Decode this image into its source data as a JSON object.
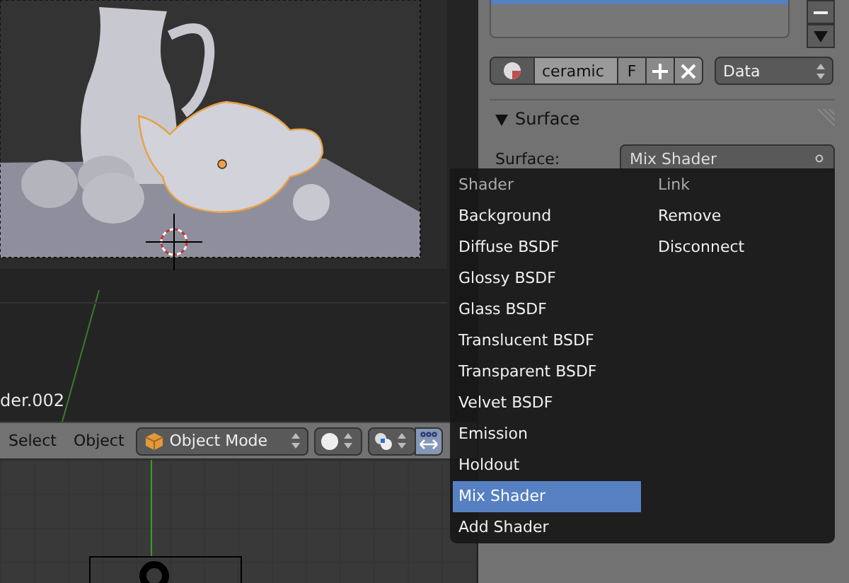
{
  "viewport": {
    "object_name": "der.002"
  },
  "header": {
    "menus": [
      "Select",
      "Object"
    ],
    "mode": "Object Mode"
  },
  "properties": {
    "material": {
      "name": "ceramic",
      "fake_user": "F",
      "link": "Data"
    },
    "surface_panel": {
      "title": "Surface",
      "expanded": true,
      "field_label": "Surface:",
      "value": "Mix Shader"
    }
  },
  "menu": {
    "columns": [
      {
        "title": "Shader",
        "items": [
          {
            "label": "Background",
            "selected": false
          },
          {
            "label": "Diffuse BSDF",
            "selected": false
          },
          {
            "label": "Glossy BSDF",
            "selected": false
          },
          {
            "label": "Glass BSDF",
            "selected": false
          },
          {
            "label": "Translucent BSDF",
            "selected": false
          },
          {
            "label": "Transparent BSDF",
            "selected": false
          },
          {
            "label": "Velvet BSDF",
            "selected": false
          },
          {
            "label": "Emission",
            "selected": false
          },
          {
            "label": "Holdout",
            "selected": false
          },
          {
            "label": "Mix Shader",
            "selected": true
          },
          {
            "label": "Add Shader",
            "selected": false
          }
        ]
      },
      {
        "title": "Link",
        "items": [
          {
            "label": "Remove",
            "selected": false
          },
          {
            "label": "Disconnect",
            "selected": false
          }
        ]
      }
    ]
  }
}
